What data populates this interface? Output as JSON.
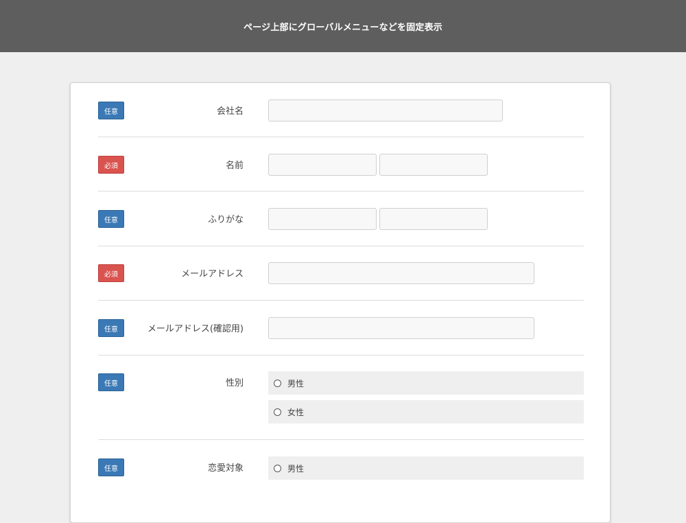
{
  "header": {
    "title": "ページ上部にグローバルメニューなどを固定表示"
  },
  "badges": {
    "optional": "任意",
    "required": "必須"
  },
  "fields": {
    "company": {
      "label": "会社名",
      "value": "",
      "placeholder": ""
    },
    "name": {
      "label": "名前",
      "last": "",
      "first": ""
    },
    "furigana": {
      "label": "ふりがな",
      "last": "",
      "first": ""
    },
    "email": {
      "label": "メールアドレス",
      "value": ""
    },
    "email_confirm": {
      "label": "メールアドレス(確認用)",
      "value": ""
    },
    "gender": {
      "label": "性別",
      "options": [
        "男性",
        "女性"
      ]
    },
    "love_target": {
      "label": "恋愛対象",
      "options": [
        "男性"
      ]
    }
  },
  "colors": {
    "header_bg": "#5e5e5e",
    "optional_badge": "#3a79b5",
    "required_badge": "#d9534f"
  }
}
